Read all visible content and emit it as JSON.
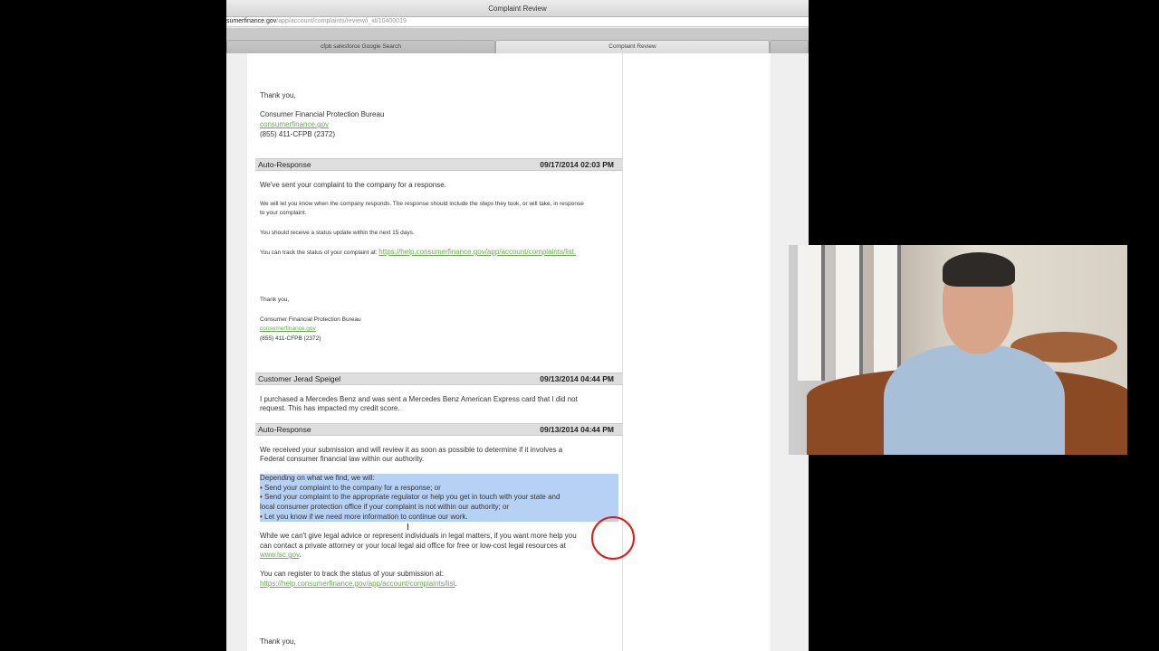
{
  "browser": {
    "window_title": "Complaint Review",
    "url_host": "sumerfinance.gov",
    "url_path": "/app/account/complaints/review/i_id/10400019",
    "tabs": [
      {
        "label": "cfpb salesforce    Google Search"
      },
      {
        "label": "Complaint Review"
      },
      {
        "label": ""
      }
    ]
  },
  "messages": {
    "top_signature": {
      "thanks": "Thank you,",
      "org": "Consumer Financial Protection Bureau",
      "link": "consumerfinance.gov",
      "phone": "(855) 411-CFPB (2372)"
    },
    "auto1": {
      "sender": "Auto-Response",
      "date": "09/17/2014 02:03 PM",
      "line1": "We've sent your complaint to the company for a response.",
      "line2a": "We will let you know when the company responds. The response should include the steps they took, or will take, in response",
      "line2b": "to your complaint.",
      "line3": "You should receive a status update within the next 15 days.",
      "line4": "You can track the status of your complaint at:",
      "line4_link": "https://help.consumerfinance.gov/app/account/complaints/list.",
      "thanks": "Thank you,",
      "org": "Consumer Financial Protection Bureau",
      "link": "consumerfinance.gov",
      "phone": "(855) 411-CFPB (2372)"
    },
    "customer": {
      "sender": "Customer Jerad Speigel",
      "date": "09/13/2014 04:44 PM",
      "line1": "I purchased a Mercedes Benz and was sent a Mercedes Benz American Express card that I did not",
      "line2": "request. This has impacted my credit score."
    },
    "auto2": {
      "sender": "Auto-Response",
      "date": "09/13/2014 04:44 PM",
      "p1a": "We received your submission and will review it as soon as possible to determine if it involves a",
      "p1b": "Federal consumer financial law within our authority.",
      "h1": "Depending on what we find, we will:",
      "h2": "• Send your complaint to the company for a response; or",
      "h3": "• Send your complaint to the appropriate regulator or help you get in touch with your state and",
      "h4": "local consumer protection office if your complaint is not within our authority; or",
      "h5": "• Let you know if we need more information to continue our work.",
      "p3a": "While we can't give legal advice or represent individuals in legal matters, if you want more help you",
      "p3b": "can contact a private attorney or your local legal aid office for free or low-cost legal resources at",
      "p3c_link": "www.lsc.gov",
      "p3c_end": ".",
      "p4": "You can register to track the status of your submission at:",
      "p4_link": "https://help.consumerfinance.gov/app/account/complaints/list",
      "p4_end": ".",
      "thanks": "Thank you,"
    }
  }
}
